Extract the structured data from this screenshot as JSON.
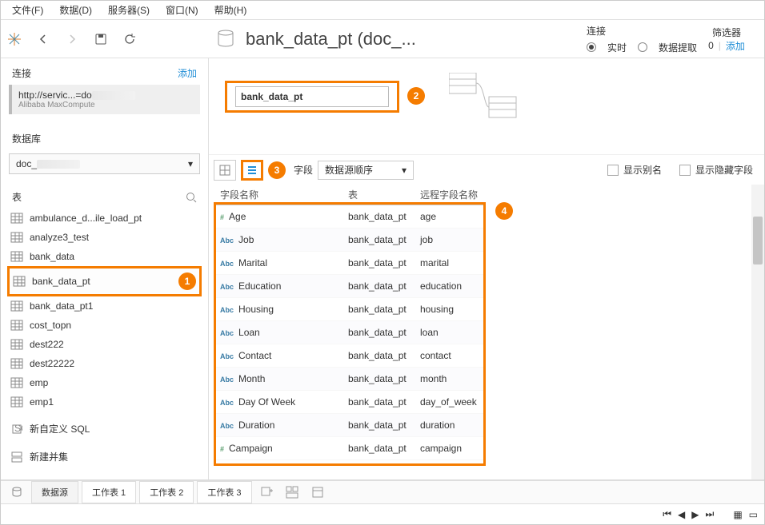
{
  "menu": [
    "文件(F)",
    "数据(D)",
    "服务器(S)",
    "窗口(N)",
    "帮助(H)"
  ],
  "title": "bank_data_pt (doc_...",
  "connection": {
    "label": "连接",
    "live": "实时",
    "extract": "数据提取"
  },
  "filter": {
    "label": "筛选器",
    "count": "0",
    "add": "添加"
  },
  "sidebar": {
    "conn_label": "连接",
    "add": "添加",
    "url": "http://servic...=do",
    "source": "Alibaba MaxCompute",
    "db_label": "数据库",
    "db_value": "doc_",
    "tables_label": "表",
    "tables": [
      "ambulance_d...ile_load_pt",
      "analyze3_test",
      "bank_data",
      "bank_data_pt",
      "bank_data_pt1",
      "cost_topn",
      "dest222",
      "dest22222",
      "emp",
      "emp1"
    ],
    "selected_index": 3,
    "custom_sql": "新自定义 SQL",
    "new_union": "新建并集"
  },
  "drop_table": "bank_data_pt",
  "field_bar": {
    "label": "字段",
    "sort": "数据源顺序",
    "show_alias": "显示别名",
    "show_hidden": "显示隐藏字段"
  },
  "grid": {
    "headers": [
      "字段名称",
      "表",
      "远程字段名称"
    ],
    "rows": [
      {
        "type": "#",
        "name": "Age",
        "table": "bank_data_pt",
        "remote": "age"
      },
      {
        "type": "Abc",
        "name": "Job",
        "table": "bank_data_pt",
        "remote": "job"
      },
      {
        "type": "Abc",
        "name": "Marital",
        "table": "bank_data_pt",
        "remote": "marital"
      },
      {
        "type": "Abc",
        "name": "Education",
        "table": "bank_data_pt",
        "remote": "education"
      },
      {
        "type": "Abc",
        "name": "Housing",
        "table": "bank_data_pt",
        "remote": "housing"
      },
      {
        "type": "Abc",
        "name": "Loan",
        "table": "bank_data_pt",
        "remote": "loan"
      },
      {
        "type": "Abc",
        "name": "Contact",
        "table": "bank_data_pt",
        "remote": "contact"
      },
      {
        "type": "Abc",
        "name": "Month",
        "table": "bank_data_pt",
        "remote": "month"
      },
      {
        "type": "Abc",
        "name": "Day Of Week",
        "table": "bank_data_pt",
        "remote": "day_of_week"
      },
      {
        "type": "Abc",
        "name": "Duration",
        "table": "bank_data_pt",
        "remote": "duration"
      },
      {
        "type": "#",
        "name": "Campaign",
        "table": "bank_data_pt",
        "remote": "campaign"
      }
    ]
  },
  "tabs": {
    "ds": "数据源",
    "ws": [
      "工作表 1",
      "工作表 2",
      "工作表 3"
    ]
  },
  "badges": {
    "one": "1",
    "two": "2",
    "three": "3",
    "four": "4"
  }
}
